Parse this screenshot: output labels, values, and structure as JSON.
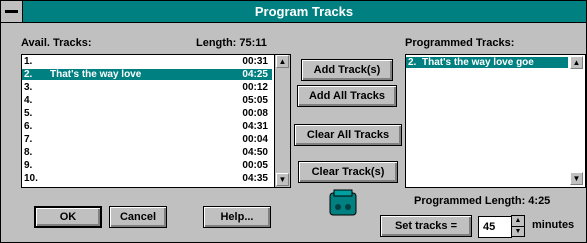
{
  "window": {
    "title": "Program Tracks"
  },
  "avail": {
    "label": "Avail. Tracks:",
    "length_label": "Length: 75:11",
    "tracks": [
      {
        "num": "1.",
        "title": "",
        "dur": "00:31"
      },
      {
        "num": "2.",
        "title": "That's the way love",
        "dur": "04:25",
        "selected": true
      },
      {
        "num": "3.",
        "title": "",
        "dur": "00:12"
      },
      {
        "num": "4.",
        "title": "",
        "dur": "05:05"
      },
      {
        "num": "5.",
        "title": "",
        "dur": "00:08"
      },
      {
        "num": "6.",
        "title": "",
        "dur": "04:31"
      },
      {
        "num": "7.",
        "title": "",
        "dur": "00:04"
      },
      {
        "num": "8.",
        "title": "",
        "dur": "04:50"
      },
      {
        "num": "9.",
        "title": "",
        "dur": "00:05"
      },
      {
        "num": "10.",
        "title": "",
        "dur": "04:35"
      }
    ]
  },
  "buttons": {
    "add_track": "Add Track(s)",
    "add_all": "Add All Tracks",
    "clear_all": "Clear All Tracks",
    "clear_track": "Clear Track(s)",
    "ok": "OK",
    "cancel": "Cancel",
    "help": "Help...",
    "set_tracks": "Set tracks ="
  },
  "programmed": {
    "label": "Programmed Tracks:",
    "tracks": [
      {
        "num": "2.",
        "title": "That's the way love goe"
      }
    ],
    "length_label": "Programmed Length: 4:25"
  },
  "minutes": {
    "value": "45",
    "unit_label": "minutes"
  },
  "colors": {
    "teal": "#008080",
    "face": "#c0c0c0"
  },
  "icons": [
    "system-menu-icon",
    "scroll-up-icon",
    "scroll-down-icon",
    "disc-icon",
    "spin-up-icon",
    "spin-down-icon"
  ]
}
